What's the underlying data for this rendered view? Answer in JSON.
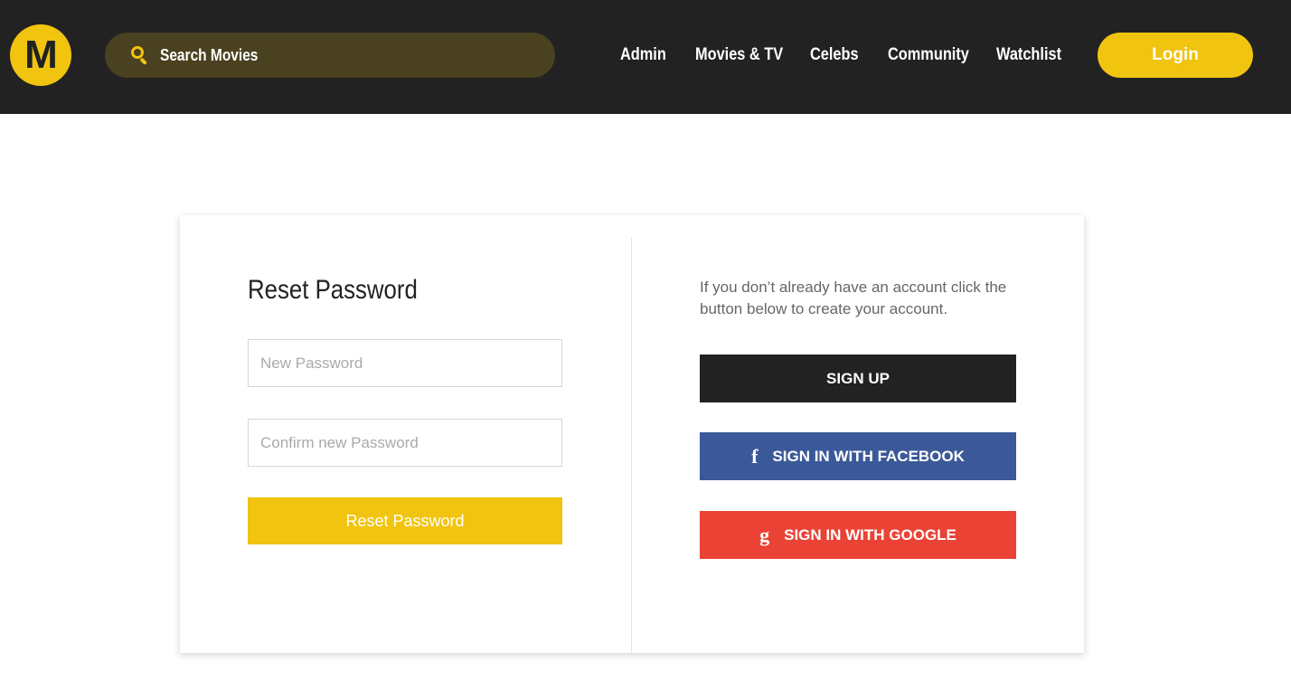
{
  "header": {
    "logo_letter": "M",
    "search_placeholder": "Search Movies",
    "nav": [
      "Admin",
      "Movies & TV",
      "Celebs",
      "Community",
      "Watchlist"
    ],
    "login_label": "Login"
  },
  "reset_form": {
    "title": "Reset Password",
    "new_password_placeholder": "New Password",
    "confirm_password_placeholder": "Confirm new Password",
    "submit_label": "Reset Password"
  },
  "signup_panel": {
    "info_text": "If you don’t already have an account click the button below to create your account.",
    "signup_label": "SIGN UP",
    "facebook_label": "SIGN IN WITH FACEBOOK",
    "facebook_icon_glyph": "f",
    "google_label": "SIGN IN WITH GOOGLE",
    "google_icon_glyph": "g"
  },
  "colors": {
    "header_bg": "#222222",
    "accent": "#f1c40f",
    "facebook": "#3b5998",
    "google": "#ea4335"
  }
}
